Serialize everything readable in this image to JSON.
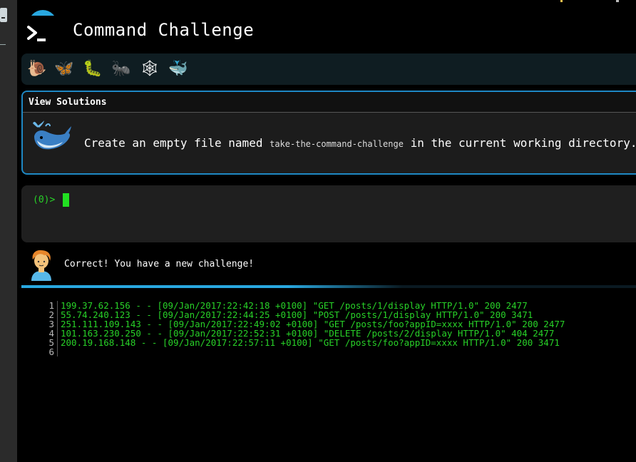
{
  "header": {
    "title": "Command Challenge"
  },
  "levels": [
    {
      "icon": "snail-icon",
      "glyph": "🐌"
    },
    {
      "icon": "butterfly-icon",
      "glyph": "🦋"
    },
    {
      "icon": "caterpillar-icon",
      "glyph": "🐛"
    },
    {
      "icon": "ant-icon",
      "glyph": "🐜"
    },
    {
      "icon": "spider-web-icon",
      "glyph": "🕸"
    },
    {
      "icon": "whale-icon",
      "glyph": "🐳"
    }
  ],
  "card": {
    "header": "View Solutions",
    "challenge_pre": "Create an empty file named",
    "challenge_code": "take-the-command-challenge",
    "challenge_post": "in the current working directory."
  },
  "terminal": {
    "prompt": "(0)>"
  },
  "message": {
    "text": "Correct! You have a new challenge!"
  },
  "progress": {
    "fraction": 0.62
  },
  "listing": {
    "lines": [
      {
        "num": "1",
        "text": "199.37.62.156 - - [09/Jan/2017:22:42:18 +0100] \"GET /posts/1/display HTTP/1.0\" 200 2477"
      },
      {
        "num": "2",
        "text": "55.74.240.123 - - [09/Jan/2017:22:44:25 +0100] \"POST /posts/1/display HTTP/1.0\" 200 3471"
      },
      {
        "num": "3",
        "text": "251.111.109.143 - - [09/Jan/2017:22:49:02 +0100] \"GET /posts/foo?appID=xxxx HTTP/1.0\" 200 2477"
      },
      {
        "num": "4",
        "text": "101.163.230.250 - - [09/Jan/2017:22:52:31 +0100] \"DELETE /posts/2/display HTTP/1.0\" 404 2477"
      },
      {
        "num": "5",
        "text": "200.19.168.148 - - [09/Jan/2017:22:57:11 +0100] \"GET /posts/foo?appID=xxxx HTTP/1.0\" 200 3471"
      },
      {
        "num": "6",
        "text": ""
      }
    ]
  },
  "colors": {
    "accent": "#29a8e0",
    "terminal_green": "#28d228",
    "background": "#000000"
  }
}
